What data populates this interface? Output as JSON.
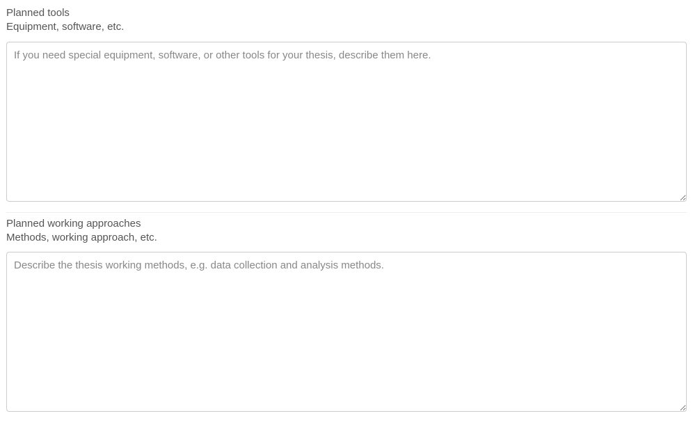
{
  "sections": {
    "tools": {
      "label": "Planned tools",
      "sublabel": "Equipment, software, etc.",
      "placeholder": "If you need special equipment, software, or other tools for your thesis, describe them here.",
      "value": ""
    },
    "approaches": {
      "label": "Planned working approaches",
      "sublabel": "Methods, working approach, etc.",
      "placeholder": "Describe the thesis working methods, e.g. data collection and analysis methods.",
      "value": ""
    }
  }
}
